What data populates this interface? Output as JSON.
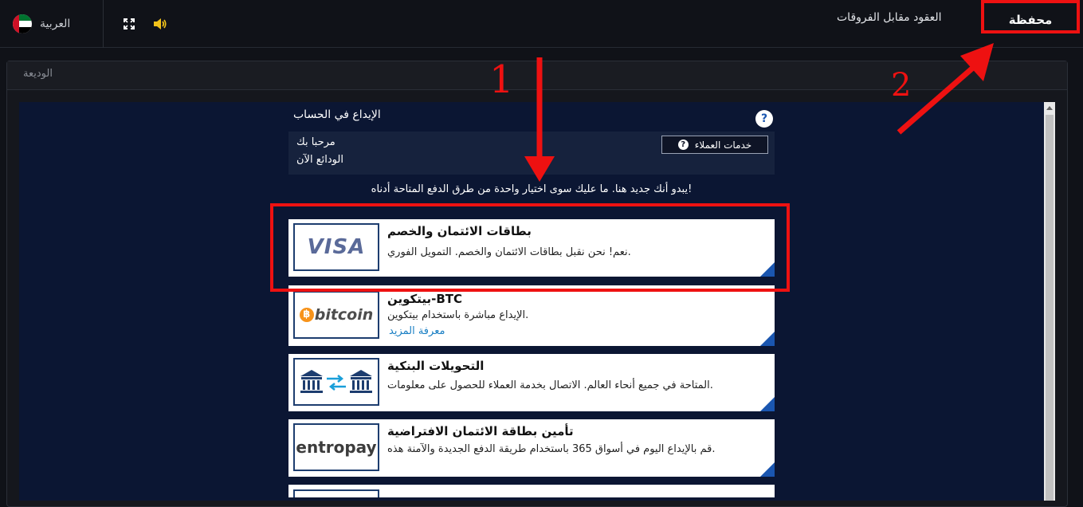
{
  "header": {
    "language_label": "العربية",
    "nav_cfd_label": "العقود مقابل الفروقات",
    "nav_wallet_label": "محفظة"
  },
  "panel": {
    "title": "الوديعة"
  },
  "deposit": {
    "title": "الإيداع في الحساب",
    "help_glyph": "?",
    "welcome_line1": "مرحبا بك",
    "welcome_line2": "الودائع الآن",
    "customer_service_label": "خدمات العملاء",
    "intro_text": "يبدو أنك جديد هنا. ما عليك سوى اختيار واحدة من طرق الدفع المتاحة أدناه!"
  },
  "methods": [
    {
      "logo": "VISA",
      "title": "بطاقات الائتمان والخصم",
      "desc": "نعم! نحن نقبل بطاقات الائتمان والخصم. التمويل الفوري."
    },
    {
      "logo": "bitcoin",
      "title": "بيتكوين-BTC",
      "desc": "الإيداع مباشرة باستخدام بيتكوين.",
      "link": "معرفة المزيد"
    },
    {
      "logo": "bank-transfer-icon",
      "title": "التحويلات البنكية",
      "desc": "المتاحة في جميع أنحاء العالم. الاتصال بخدمة العملاء للحصول على معلومات."
    },
    {
      "logo": "entropay",
      "title": "تأمين بطاقة الائتمان الافتراضية",
      "desc": "قم بالإيداع اليوم في أسواق 365 باستخدام طريقة الدفع الجديدة والآمنة هذه."
    }
  ],
  "annotations": {
    "step1": "1",
    "step2": "2"
  },
  "colors": {
    "accent_red": "#ee1111",
    "card_corner": "#1a56b0",
    "inner_bg": "#0b1633"
  }
}
